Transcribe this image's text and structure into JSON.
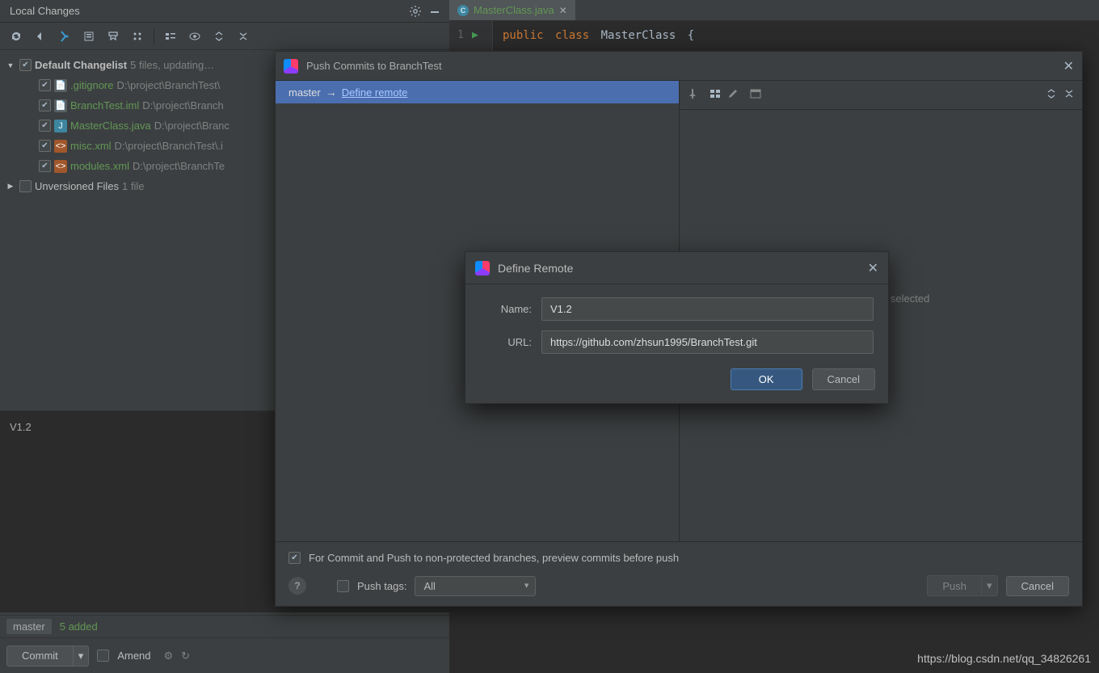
{
  "local_changes": {
    "title": "Local Changes",
    "changelist": {
      "name": "Default Changelist",
      "status": "5 files, updating…"
    },
    "files": [
      {
        "name": ".gitignore",
        "path": "D:\\project\\BranchTest\\"
      },
      {
        "name": "BranchTest.iml",
        "path": "D:\\project\\Branch"
      },
      {
        "name": "MasterClass.java",
        "path": "D:\\project\\Branc"
      },
      {
        "name": "misc.xml",
        "path": "D:\\project\\BranchTest\\.i"
      },
      {
        "name": "modules.xml",
        "path": "D:\\project\\BranchTe"
      }
    ],
    "unversioned": {
      "label": "Unversioned Files",
      "count": "1 file"
    },
    "commit_message": "V1.2",
    "branch": "master",
    "added_label": "5 added",
    "commit_btn": "Commit",
    "amend_label": "Amend"
  },
  "editor": {
    "tab_file": "MasterClass.java",
    "line_number": "1",
    "kw_public": "public",
    "kw_class": "class",
    "class_name": "MasterClass",
    "brace": "{"
  },
  "push_dialog": {
    "title": "Push Commits to BranchTest",
    "branch": "master",
    "arrow": "→",
    "define_remote_link": "Define remote",
    "no_commits": "No commits selected",
    "preview_checkbox": "For Commit and Push to non-protected branches, preview commits before push",
    "push_tags_label": "Push tags:",
    "push_tags_value": "All",
    "push_btn": "Push",
    "cancel_btn": "Cancel"
  },
  "define_remote": {
    "title": "Define Remote",
    "name_label": "Name:",
    "name_value": "V1.2",
    "url_label": "URL:",
    "url_value": "https://github.com/zhsun1995/BranchTest.git",
    "ok": "OK",
    "cancel": "Cancel"
  },
  "watermark": "https://blog.csdn.net/qq_34826261"
}
